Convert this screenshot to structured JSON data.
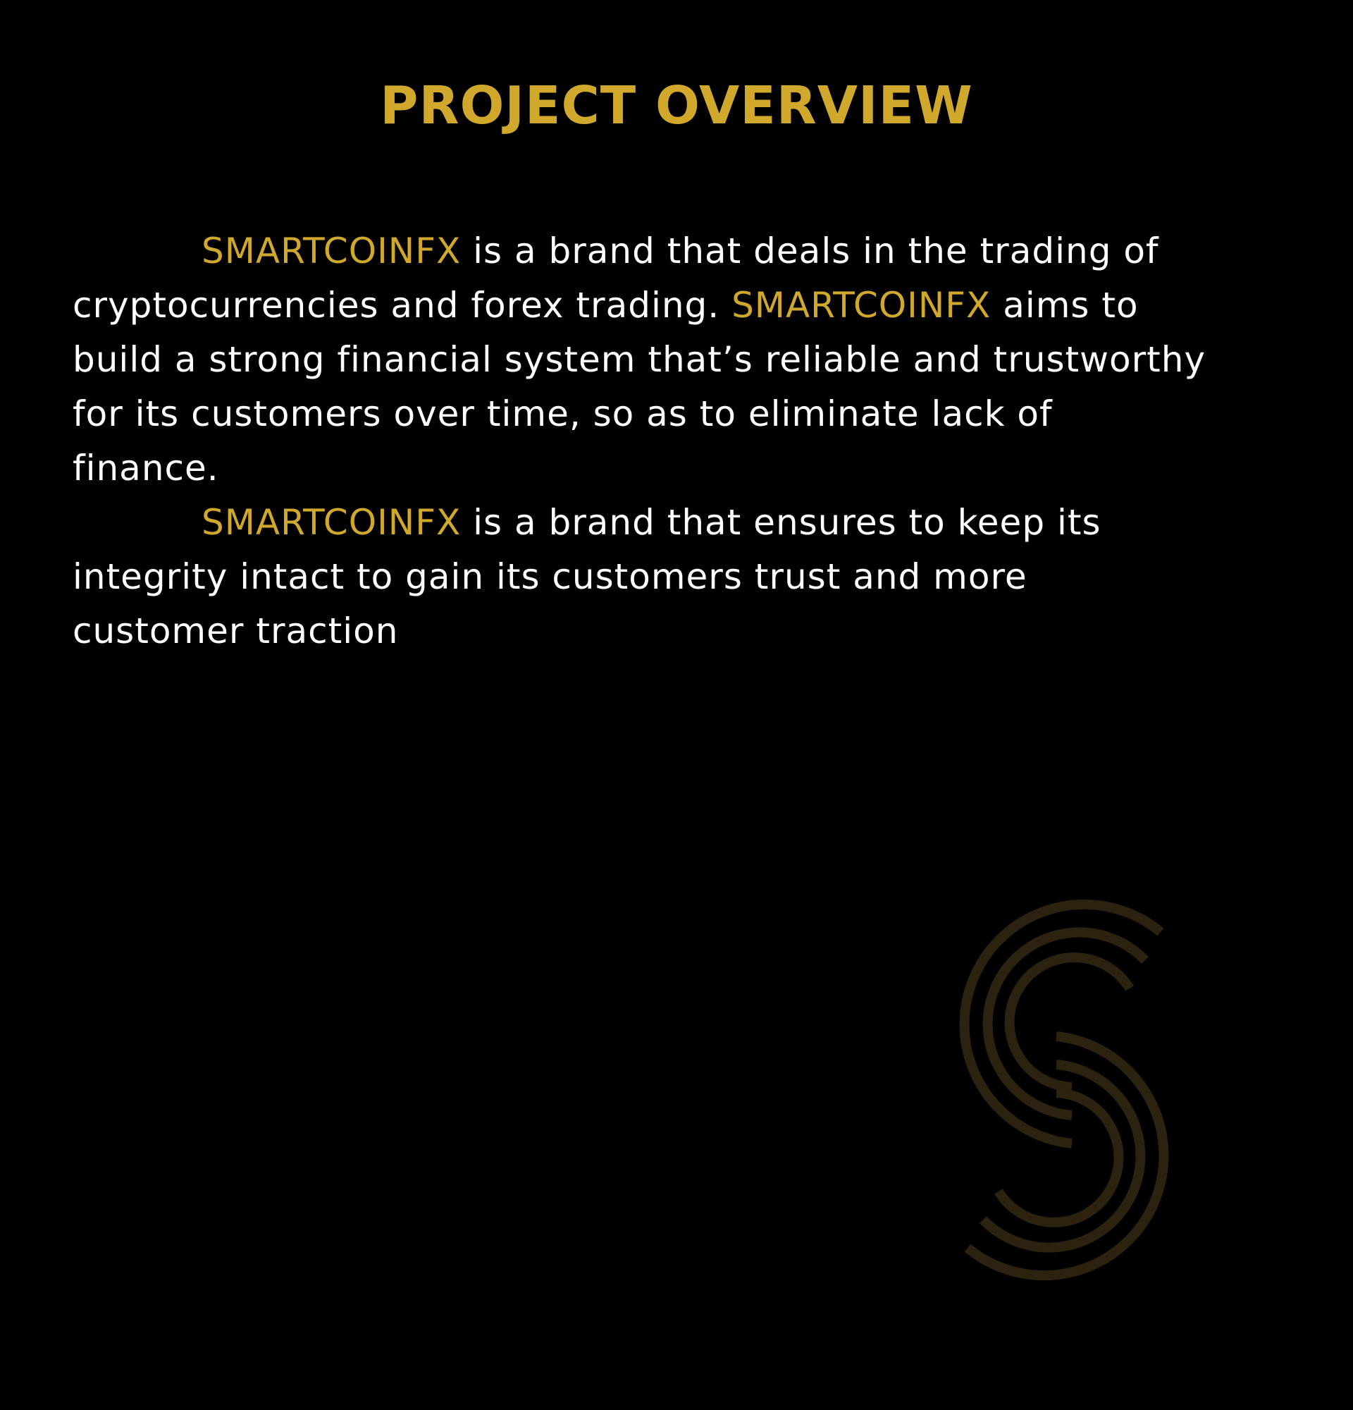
{
  "title": "PROJECT OVERVIEW",
  "brand": "SMARTCOINFX",
  "paragraphs": [
    {
      "lines": [
        {
          "brand": "SMARTCOINFX",
          "text": " is a brand that deals in the trading of"
        },
        {
          "text": "cryptocurrencies and forex trading. ",
          "brand": "SMARTCOINFX",
          "after": " aims to"
        },
        {
          "text": "build a strong financial system that’s reliable and trustworthy"
        },
        {
          "text": "for its customers over time, so as to eliminate lack of"
        },
        {
          "text": "finance."
        }
      ]
    },
    {
      "lines": [
        {
          "brand": "SMARTCOINFX",
          "text": " is a brand that ensures to keep its"
        },
        {
          "text": "integrity intact to gain its customers trust and more"
        },
        {
          "text": "customer traction"
        }
      ]
    }
  ],
  "colors": {
    "background": "#000000",
    "accent": "#d0a92c",
    "text": "#ffffff",
    "watermark": "#2b2210"
  },
  "logo": {
    "icon": "s-swirl-logo-icon"
  }
}
